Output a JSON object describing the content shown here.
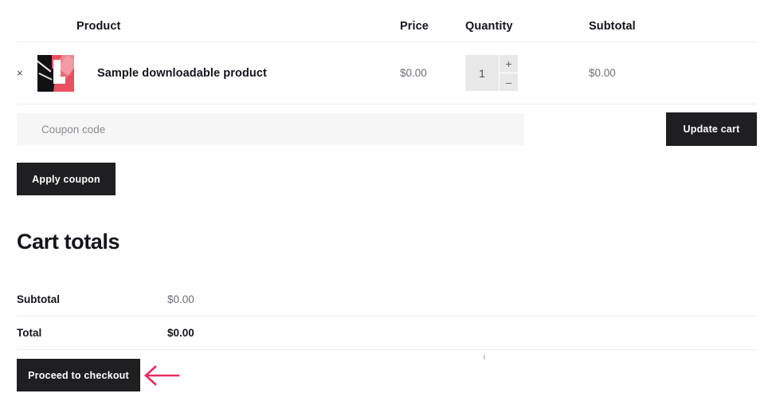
{
  "cart": {
    "columns": {
      "product": "Product",
      "price": "Price",
      "quantity": "Quantity",
      "subtotal": "Subtotal"
    },
    "items": [
      {
        "remove_label": "×",
        "thumbnail_icon": "product-thumbnail-red-black-l",
        "name": "Sample downloadable product",
        "price": "$0.00",
        "quantity": "1",
        "increase_label": "+",
        "decrease_label": "–",
        "subtotal": "$0.00"
      }
    ]
  },
  "coupon": {
    "placeholder": "Coupon code",
    "value": "",
    "apply_label": "Apply coupon"
  },
  "actions": {
    "update_cart_label": "Update cart",
    "checkout_label": "Proceed to checkout"
  },
  "totals": {
    "title": "Cart totals",
    "rows": [
      {
        "label": "Subtotal",
        "value": "$0.00"
      },
      {
        "label": "Total",
        "value": "$0.00"
      }
    ]
  },
  "annotation": {
    "arrow_icon": "arrow-left-icon",
    "arrow_color": "#ea2c60"
  },
  "colors": {
    "button_dark": "#1f1f22",
    "field_background": "#f6f6f6",
    "divider": "#ededed",
    "muted_text": "#6d6d78"
  }
}
